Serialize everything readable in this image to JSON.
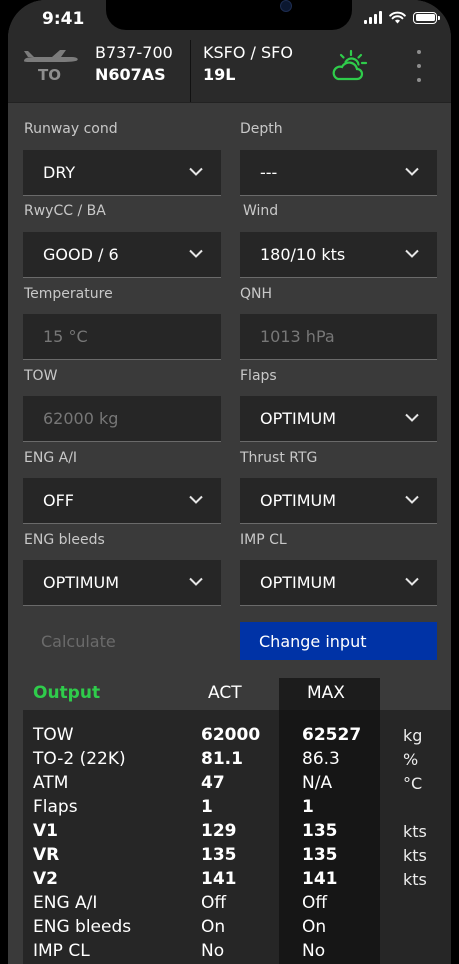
{
  "status": {
    "time": "9:41"
  },
  "header": {
    "phase": "TO",
    "aircraft_type": "B737-700",
    "registration": "N607AS",
    "airport": "KSFO / SFO",
    "runway": "19L",
    "icons": {
      "aircraft": "airplane-icon",
      "weather": "partly-cloudy-icon",
      "menu": "more-vertical-icon"
    },
    "weather_color": "#2fcc4b"
  },
  "inputs": {
    "runway_cond": {
      "label": "Runway cond",
      "value": "DRY"
    },
    "depth": {
      "label": "Depth",
      "value": "---"
    },
    "rwycc": {
      "label": "RwyCC / BA",
      "value": "GOOD / 6"
    },
    "wind": {
      "label": "Wind",
      "value": "180/10 kts"
    },
    "temperature": {
      "label": "Temperature",
      "value": "15 °C"
    },
    "qnh": {
      "label": "QNH",
      "value": "1013 hPa"
    },
    "tow": {
      "label": "TOW",
      "value": "62000 kg"
    },
    "flaps": {
      "label": "Flaps",
      "value": "OPTIMUM"
    },
    "eng_ai": {
      "label": "ENG A/I",
      "value": "OFF"
    },
    "thrust_rtg": {
      "label": "Thrust RTG",
      "value": "OPTIMUM"
    },
    "eng_bleeds": {
      "label": "ENG bleeds",
      "value": "OPTIMUM"
    },
    "imp_cl": {
      "label": "IMP CL",
      "value": "OPTIMUM"
    }
  },
  "buttons": {
    "calculate": "Calculate",
    "change_input": "Change input",
    "accent_color": "#0033a6"
  },
  "output": {
    "title": "Output",
    "col_act": "ACT",
    "col_max": "MAX",
    "rows": [
      {
        "label": "TOW",
        "act": "62000",
        "max": "62527",
        "unit": "kg"
      },
      {
        "label": "TO-2 (22K)",
        "act": "81.1",
        "max": "86.3",
        "unit": "%"
      },
      {
        "label": "ATM",
        "act": "47",
        "max": "N/A",
        "unit": "°C"
      },
      {
        "label": "Flaps",
        "act": "1",
        "max": "1",
        "unit": ""
      },
      {
        "label": "V1",
        "act": "129",
        "max": "135",
        "unit": "kts"
      },
      {
        "label": "VR",
        "act": "135",
        "max": "135",
        "unit": "kts"
      },
      {
        "label": "V2",
        "act": "141",
        "max": "141",
        "unit": "kts"
      },
      {
        "label": "ENG A/I",
        "act": "Off",
        "max": "Off",
        "unit": ""
      },
      {
        "label": "ENG bleeds",
        "act": "On",
        "max": "On",
        "unit": ""
      },
      {
        "label": "IMP CL",
        "act": "No",
        "max": "No",
        "unit": ""
      }
    ]
  }
}
